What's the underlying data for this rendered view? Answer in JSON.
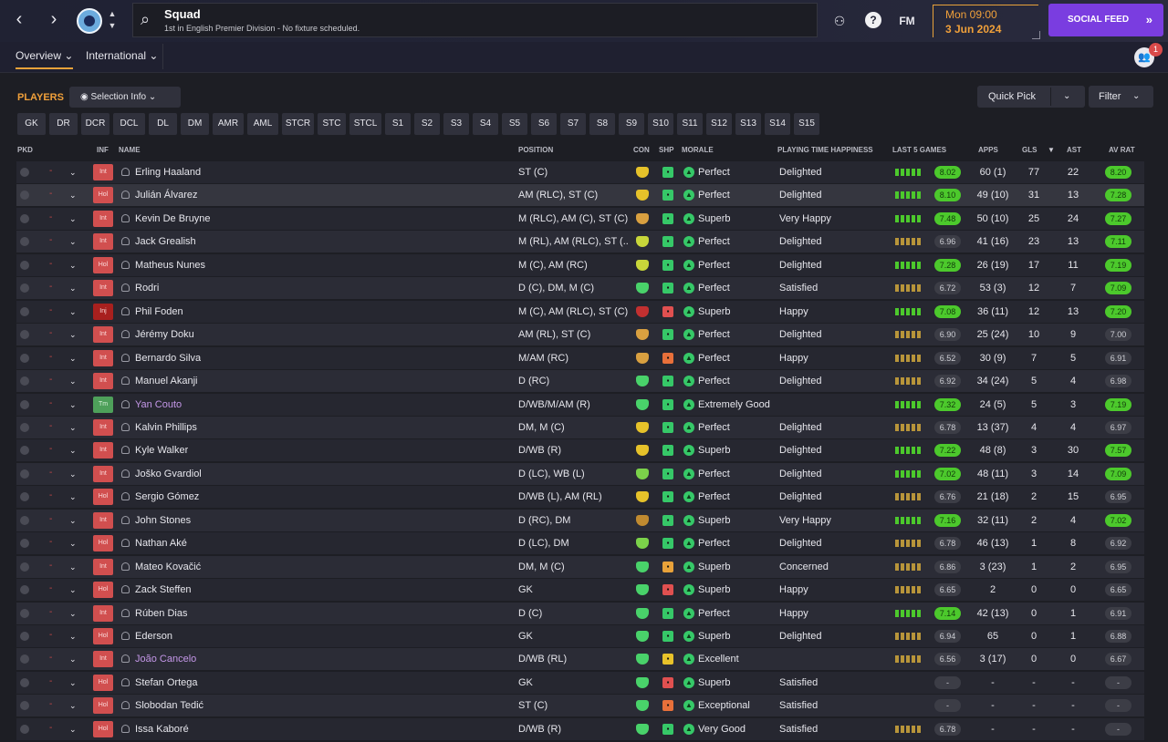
{
  "header": {
    "title": "Squad",
    "subtitle": "1st in English Premier Division - No fixture scheduled.",
    "fm_label": "FM",
    "date_time": "Mon 09:00",
    "date": "3 Jun 2024",
    "social_feed": "SOCIAL FEED",
    "notification_count": "1"
  },
  "tabs": [
    {
      "label": "Overview"
    },
    {
      "label": "International"
    }
  ],
  "toolbar": {
    "players_label": "PLAYERS",
    "selection_info": "Selection Info",
    "quick_pick": "Quick Pick",
    "filter": "Filter"
  },
  "positions": [
    "GK",
    "DR",
    "DCR",
    "DCL",
    "DL",
    "DM",
    "AMR",
    "AML",
    "STCR",
    "STC",
    "STCL",
    "S1",
    "S2",
    "S3",
    "S4",
    "S5",
    "S6",
    "S7",
    "S8",
    "S9",
    "S10",
    "S11",
    "S12",
    "S13",
    "S14",
    "S15"
  ],
  "columns": {
    "pkd": "PKD",
    "inf": "INF",
    "name": "NAME",
    "position": "POSITION",
    "con": "CON",
    "shp": "SHP",
    "morale": "MORALE",
    "pth": "PLAYING TIME HAPPINESS",
    "last5": "LAST 5 GAMES",
    "apps": "APPS",
    "gls": "GLS",
    "ast": "AST",
    "avrat": "AV RAT"
  },
  "colors": {
    "accent": "#f0a03a",
    "social": "#7a3de0",
    "good": "#4cc92c",
    "bad": "#d14f4f"
  },
  "players": [
    {
      "inf": "Int",
      "name": "Erling Haaland",
      "position": "ST (C)",
      "morale": "Perfect",
      "pth": "Delighted",
      "last5": "8.02",
      "apps": "60 (1)",
      "gls": "77",
      "ast": "22",
      "avrat": "8.20",
      "last5_good": true,
      "avrat_good": true
    },
    {
      "inf": "Hol",
      "name": "Julián Álvarez",
      "position": "AM (RLC), ST (C)",
      "morale": "Perfect",
      "pth": "Delighted",
      "last5": "8.10",
      "apps": "49 (10)",
      "gls": "31",
      "ast": "13",
      "avrat": "7.28",
      "last5_good": true,
      "avrat_good": true
    },
    {
      "inf": "Int",
      "name": "Kevin De Bruyne",
      "position": "M (RLC), AM (C), ST (C)",
      "morale": "Superb",
      "pth": "Very Happy",
      "last5": "7.48",
      "apps": "50 (10)",
      "gls": "25",
      "ast": "24",
      "avrat": "7.27",
      "last5_good": true,
      "avrat_good": true
    },
    {
      "inf": "Int",
      "name": "Jack Grealish",
      "position": "M (RL), AM (RLC), ST (...",
      "morale": "Perfect",
      "pth": "Delighted",
      "last5": "6.96",
      "apps": "41 (16)",
      "gls": "23",
      "ast": "13",
      "avrat": "7.11",
      "last5_good": false,
      "avrat_good": true
    },
    {
      "inf": "Hol",
      "name": "Matheus Nunes",
      "position": "M (C), AM (RC)",
      "morale": "Perfect",
      "pth": "Delighted",
      "last5": "7.28",
      "apps": "26 (19)",
      "gls": "17",
      "ast": "11",
      "avrat": "7.19",
      "last5_good": true,
      "avrat_good": true
    },
    {
      "inf": "Int",
      "name": "Rodri",
      "position": "D (C), DM, M (C)",
      "morale": "Perfect",
      "pth": "Satisfied",
      "last5": "6.72",
      "apps": "53 (3)",
      "gls": "12",
      "ast": "7",
      "avrat": "7.09",
      "last5_good": false,
      "avrat_good": true
    },
    {
      "inf": "Inj",
      "name": "Phil Foden",
      "position": "M (C), AM (RLC), ST (C)",
      "morale": "Superb",
      "pth": "Happy",
      "last5": "7.08",
      "apps": "36 (11)",
      "gls": "12",
      "ast": "13",
      "avrat": "7.20",
      "last5_good": true,
      "avrat_good": true
    },
    {
      "inf": "Int",
      "name": "Jérémy Doku",
      "position": "AM (RL), ST (C)",
      "morale": "Perfect",
      "pth": "Delighted",
      "last5": "6.90",
      "apps": "25 (24)",
      "gls": "10",
      "ast": "9",
      "avrat": "7.00",
      "last5_good": false,
      "avrat_good": false
    },
    {
      "inf": "Int",
      "name": "Bernardo Silva",
      "position": "M/AM (RC)",
      "morale": "Perfect",
      "pth": "Happy",
      "last5": "6.52",
      "apps": "30 (9)",
      "gls": "7",
      "ast": "5",
      "avrat": "6.91",
      "last5_good": false,
      "avrat_good": false
    },
    {
      "inf": "Int",
      "name": "Manuel Akanji",
      "position": "D (RC)",
      "morale": "Perfect",
      "pth": "Delighted",
      "last5": "6.92",
      "apps": "34 (24)",
      "gls": "5",
      "ast": "4",
      "avrat": "6.98",
      "last5_good": false,
      "avrat_good": false
    },
    {
      "inf": "Tm",
      "name": "Yan Couto",
      "position": "D/WB/M/AM (R)",
      "morale": "Extremely Good",
      "pth": "",
      "last5": "7.32",
      "apps": "24 (5)",
      "gls": "5",
      "ast": "3",
      "avrat": "7.19",
      "last5_good": true,
      "avrat_good": true,
      "loan": true
    },
    {
      "inf": "Int",
      "name": "Kalvin Phillips",
      "position": "DM, M (C)",
      "morale": "Perfect",
      "pth": "Delighted",
      "last5": "6.78",
      "apps": "13 (37)",
      "gls": "4",
      "ast": "4",
      "avrat": "6.97",
      "last5_good": false,
      "avrat_good": false
    },
    {
      "inf": "Int",
      "name": "Kyle Walker",
      "position": "D/WB (R)",
      "morale": "Superb",
      "pth": "Delighted",
      "last5": "7.22",
      "apps": "48 (8)",
      "gls": "3",
      "ast": "30",
      "avrat": "7.57",
      "last5_good": true,
      "avrat_good": true
    },
    {
      "inf": "Int",
      "name": "Joško Gvardiol",
      "position": "D (LC), WB (L)",
      "morale": "Perfect",
      "pth": "Delighted",
      "last5": "7.02",
      "apps": "48 (11)",
      "gls": "3",
      "ast": "14",
      "avrat": "7.09",
      "last5_good": true,
      "avrat_good": true
    },
    {
      "inf": "Hol",
      "name": "Sergio Gómez",
      "position": "D/WB (L), AM (RL)",
      "morale": "Perfect",
      "pth": "Delighted",
      "last5": "6.76",
      "apps": "21 (18)",
      "gls": "2",
      "ast": "15",
      "avrat": "6.95",
      "last5_good": false,
      "avrat_good": false
    },
    {
      "inf": "Int",
      "name": "John Stones",
      "position": "D (RC), DM",
      "morale": "Superb",
      "pth": "Very Happy",
      "last5": "7.16",
      "apps": "32 (11)",
      "gls": "2",
      "ast": "4",
      "avrat": "7.02",
      "last5_good": true,
      "avrat_good": true
    },
    {
      "inf": "Hol",
      "name": "Nathan Aké",
      "position": "D (LC), DM",
      "morale": "Perfect",
      "pth": "Delighted",
      "last5": "6.78",
      "apps": "46 (13)",
      "gls": "1",
      "ast": "8",
      "avrat": "6.92",
      "last5_good": false,
      "avrat_good": false
    },
    {
      "inf": "Int",
      "name": "Mateo Kovačić",
      "position": "DM, M (C)",
      "morale": "Superb",
      "pth": "Concerned",
      "last5": "6.86",
      "apps": "3 (23)",
      "gls": "1",
      "ast": "2",
      "avrat": "6.95",
      "last5_good": false,
      "avrat_good": false
    },
    {
      "inf": "Hol",
      "name": "Zack Steffen",
      "position": "GK",
      "morale": "Superb",
      "pth": "Happy",
      "last5": "6.65",
      "apps": "2",
      "gls": "0",
      "ast": "0",
      "avrat": "6.65",
      "last5_good": false,
      "avrat_good": false
    },
    {
      "inf": "Int",
      "name": "Rúben Dias",
      "position": "D (C)",
      "morale": "Perfect",
      "pth": "Happy",
      "last5": "7.14",
      "apps": "42 (13)",
      "gls": "0",
      "ast": "1",
      "avrat": "6.91",
      "last5_good": true,
      "avrat_good": false
    },
    {
      "inf": "Hol",
      "name": "Ederson",
      "position": "GK",
      "morale": "Superb",
      "pth": "Delighted",
      "last5": "6.94",
      "apps": "65",
      "gls": "0",
      "ast": "1",
      "avrat": "6.88",
      "last5_good": false,
      "avrat_good": false
    },
    {
      "inf": "Int",
      "name": "João Cancelo",
      "position": "D/WB (RL)",
      "morale": "Excellent",
      "pth": "",
      "last5": "6.56",
      "apps": "3 (17)",
      "gls": "0",
      "ast": "0",
      "avrat": "6.67",
      "last5_good": false,
      "avrat_good": false,
      "loan": true
    },
    {
      "inf": "Hol",
      "name": "Stefan Ortega",
      "position": "GK",
      "morale": "Superb",
      "pth": "Satisfied",
      "last5": "-",
      "apps": "-",
      "gls": "-",
      "ast": "-",
      "avrat": "-",
      "last5_good": false,
      "avrat_good": false
    },
    {
      "inf": "Hol",
      "name": "Slobodan Tedić",
      "position": "ST (C)",
      "morale": "Exceptional",
      "pth": "Satisfied",
      "last5": "-",
      "apps": "-",
      "gls": "-",
      "ast": "-",
      "avrat": "-",
      "last5_good": false,
      "avrat_good": false
    },
    {
      "inf": "Hol",
      "name": "Issa Kaboré",
      "position": "D/WB (R)",
      "morale": "Very Good",
      "pth": "Satisfied",
      "last5": "6.78",
      "apps": "-",
      "gls": "-",
      "ast": "-",
      "avrat": "-",
      "last5_good": false,
      "avrat_good": false
    }
  ]
}
